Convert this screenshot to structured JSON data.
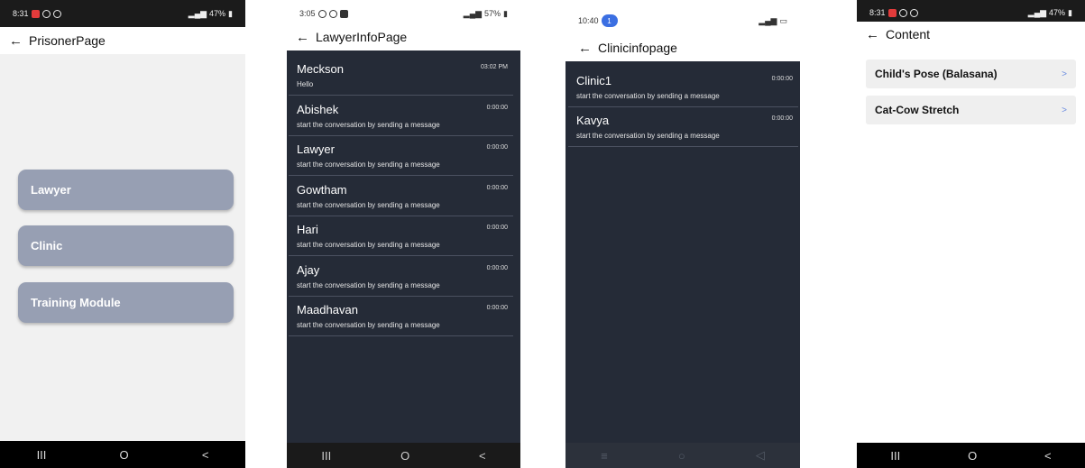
{
  "colors": {
    "dark_bg": "#252b37",
    "menu_button": "#979fb3",
    "notification_red": "#e23b3b",
    "badge_blue": "#3b6fe2",
    "chevron_blue": "#6c8de0"
  },
  "nav": {
    "recents": "III",
    "home": "O",
    "back": "<",
    "menu_alt": "≡",
    "home_alt": "○",
    "back_alt": "◁"
  },
  "back_arrow": "←",
  "phone1": {
    "status_time": "8:31",
    "status_right": "47%",
    "title": "PrisonerPage",
    "buttons": [
      "Lawyer",
      "Clinic",
      "Training Module"
    ]
  },
  "phone2": {
    "status_time": "3:05",
    "status_right": "57%",
    "title": "LawyerInfoPage",
    "chats": [
      {
        "name": "Meckson",
        "message": "Hello",
        "time": "03:02 PM"
      },
      {
        "name": "Abishek",
        "message": "start the conversation by sending a message",
        "time": "0:00:00"
      },
      {
        "name": "Lawyer",
        "message": "start the conversation by sending a message",
        "time": "0:00:00"
      },
      {
        "name": "Gowtham",
        "message": "start the conversation by sending a message",
        "time": "0:00:00"
      },
      {
        "name": "Hari",
        "message": "start the conversation by sending a message",
        "time": "0:00:00"
      },
      {
        "name": "Ajay",
        "message": "start the conversation by sending a message",
        "time": "0:00:00"
      },
      {
        "name": "Maadhavan",
        "message": "start the conversation by sending a message",
        "time": "0:00:00"
      }
    ]
  },
  "phone3": {
    "status_time": "10:40",
    "badge": "1",
    "title": "Clinicinfopage",
    "chats": [
      {
        "name": "Clinic1",
        "message": "start the conversation by sending a message",
        "time": "0:00:00"
      },
      {
        "name": "Kavya",
        "message": "start the conversation by sending a message",
        "time": "0:00:00"
      }
    ]
  },
  "phone4": {
    "status_time": "8:31",
    "status_right": "47%",
    "title": "Content",
    "items": [
      {
        "label": "Child's Pose (Balasana)",
        "chevron": ">"
      },
      {
        "label": "Cat-Cow Stretch",
        "chevron": ">"
      }
    ]
  }
}
